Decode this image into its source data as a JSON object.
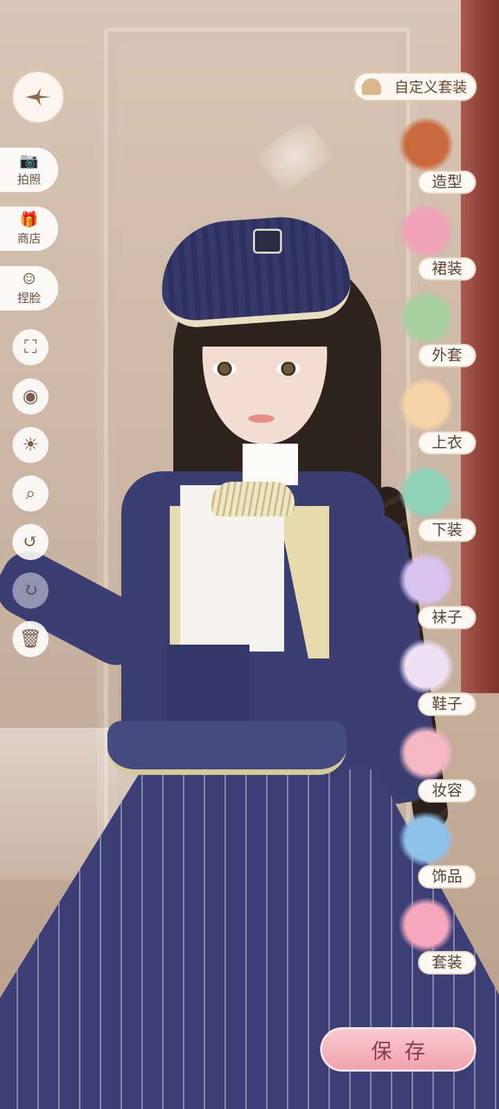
{
  "top_right": {
    "custom_outfit_label": "自定义套装"
  },
  "left_menu": [
    {
      "label": "拍照",
      "icon": "camera-icon"
    },
    {
      "label": "商店",
      "icon": "shop-icon"
    },
    {
      "label": "捏脸",
      "icon": "face-icon"
    }
  ],
  "tools": [
    {
      "icon": "fullscreen-icon",
      "glyph": "⛶"
    },
    {
      "icon": "eye-icon",
      "glyph": "◉"
    },
    {
      "icon": "brightness-icon",
      "glyph": "☀"
    },
    {
      "icon": "zoom-icon",
      "glyph": "⌕"
    },
    {
      "icon": "undo-icon",
      "glyph": "↺"
    },
    {
      "icon": "redo-icon",
      "glyph": "↻"
    },
    {
      "icon": "trash-icon",
      "glyph": "🗑"
    }
  ],
  "categories": [
    {
      "label": "造型",
      "color": "#c96a3e"
    },
    {
      "label": "裙装",
      "color": "#f0a2b8"
    },
    {
      "label": "外套",
      "color": "#a7cfa0"
    },
    {
      "label": "上衣",
      "color": "#f7d3a8"
    },
    {
      "label": "下装",
      "color": "#8fd0b9"
    },
    {
      "label": "袜子",
      "color": "#d8c3f0"
    },
    {
      "label": "鞋子",
      "color": "#efe0f4"
    },
    {
      "label": "妆容",
      "color": "#f4b9c3"
    },
    {
      "label": "饰品",
      "color": "#8fc2ea"
    },
    {
      "label": "套装",
      "color": "#f4a7bd"
    }
  ],
  "save_label": "保存",
  "colors": {
    "accent": "#f0a3ae",
    "ui_text": "#6e4f3f"
  }
}
